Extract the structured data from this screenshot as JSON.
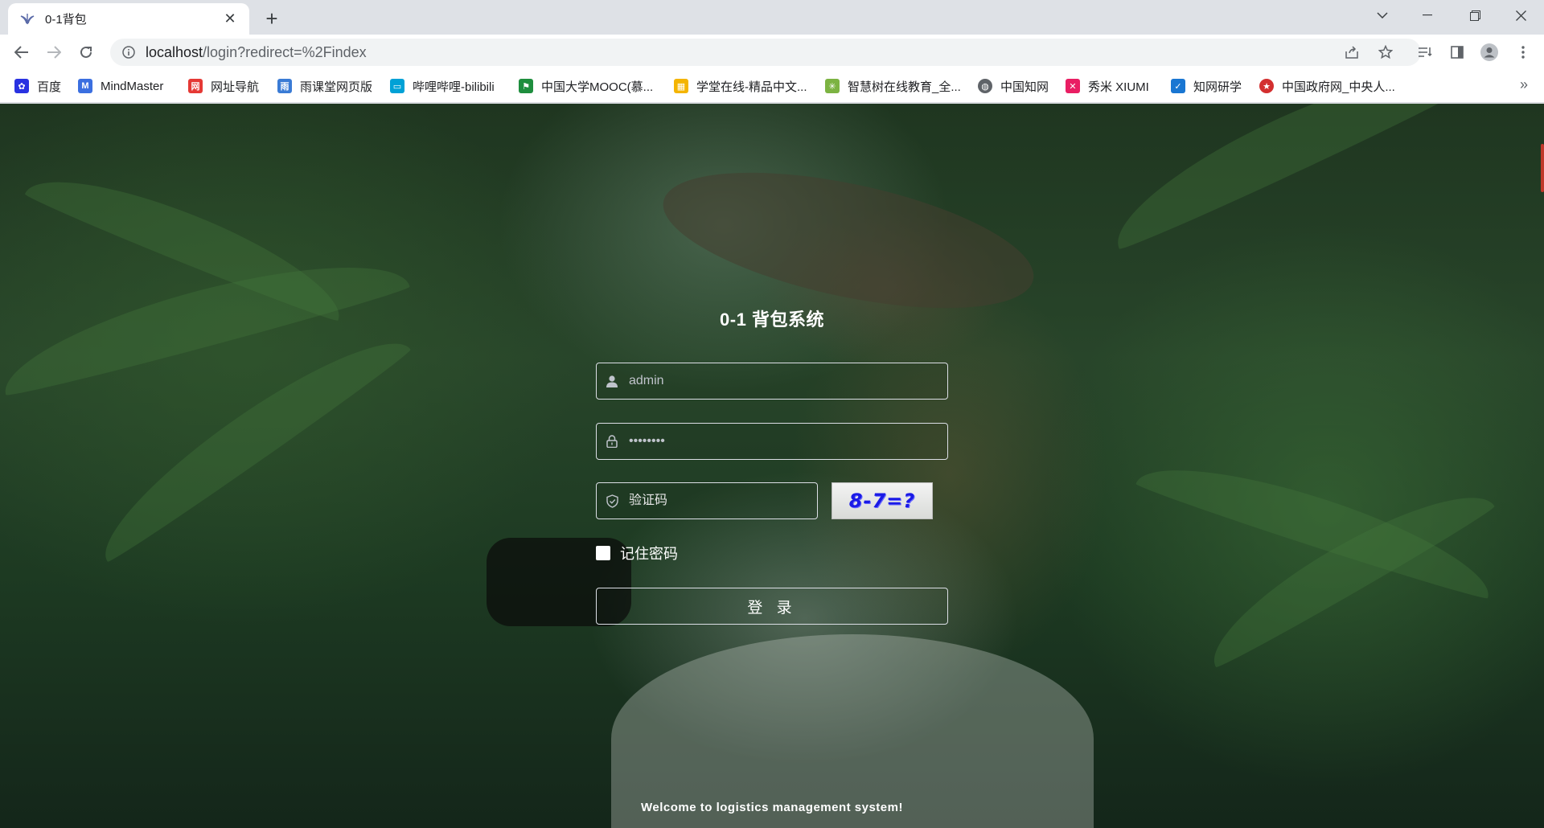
{
  "browser": {
    "tab_title": "0-1背包",
    "new_tab_symbol": "+",
    "url_host": "localhost",
    "url_path": "/login?redirect=%2Findex",
    "bookmarks": [
      {
        "label": "百度",
        "icon": "baidu-paw-icon",
        "color": "#2932e1"
      },
      {
        "label": "MindMaster",
        "icon": "mindmaster-icon",
        "color": "#3b6fe0"
      },
      {
        "label": "网址导航",
        "icon": "navigation-icon",
        "color": "#e53935"
      },
      {
        "label": "雨课堂网页版",
        "icon": "yuketang-icon",
        "color": "#3a7bd5"
      },
      {
        "label": "哔哩哔哩-bilibili",
        "icon": "bilibili-tv-icon",
        "color": "#00a1d6"
      },
      {
        "label": "中国大学MOOC(慕...",
        "icon": "mooc-flag-icon",
        "color": "#1e8e3e"
      },
      {
        "label": "学堂在线-精品中文...",
        "icon": "xuetang-icon",
        "color": "#f4b400"
      },
      {
        "label": "智慧树在线教育_全...",
        "icon": "zhihuishu-icon",
        "color": "#7cb342"
      },
      {
        "label": "中国知网",
        "icon": "globe-icon",
        "color": "#5f6368"
      },
      {
        "label": "秀米 XIUMI",
        "icon": "xiumi-icon",
        "color": "#e91e63"
      },
      {
        "label": "知网研学",
        "icon": "yanxue-icon",
        "color": "#1976d2"
      },
      {
        "label": "中国政府网_中央人...",
        "icon": "gov-emblem-icon",
        "color": "#d32f2f"
      }
    ],
    "more_symbol": "»"
  },
  "login": {
    "title": "0-1 背包系统",
    "username_value": "admin",
    "password_value": "••••••••",
    "captcha_placeholder": "验证码",
    "captcha_text": "8-7=?",
    "remember_label": "记住密码",
    "submit_label": "登 录",
    "footer": "Welcome to logistics management system!"
  }
}
